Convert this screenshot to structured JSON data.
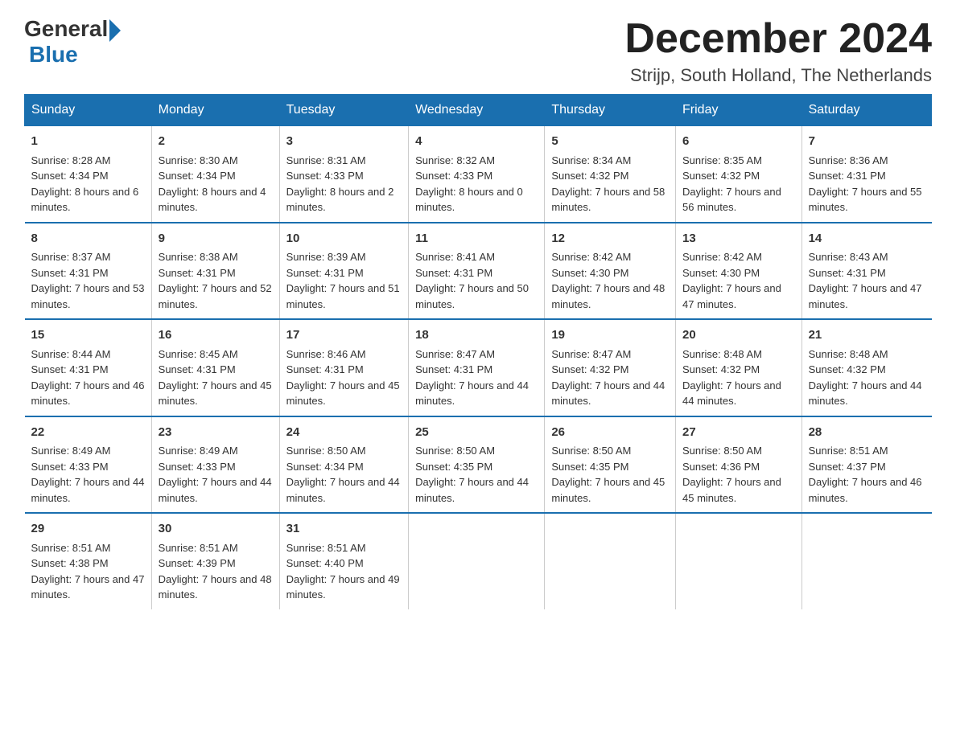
{
  "logo": {
    "general": "General",
    "blue": "Blue",
    "arrow": "▶"
  },
  "header": {
    "month_year": "December 2024",
    "location": "Strijp, South Holland, The Netherlands"
  },
  "days_of_week": [
    "Sunday",
    "Monday",
    "Tuesday",
    "Wednesday",
    "Thursday",
    "Friday",
    "Saturday"
  ],
  "weeks": [
    [
      {
        "day": "1",
        "sunrise": "8:28 AM",
        "sunset": "4:34 PM",
        "daylight": "8 hours and 6 minutes."
      },
      {
        "day": "2",
        "sunrise": "8:30 AM",
        "sunset": "4:34 PM",
        "daylight": "8 hours and 4 minutes."
      },
      {
        "day": "3",
        "sunrise": "8:31 AM",
        "sunset": "4:33 PM",
        "daylight": "8 hours and 2 minutes."
      },
      {
        "day": "4",
        "sunrise": "8:32 AM",
        "sunset": "4:33 PM",
        "daylight": "8 hours and 0 minutes."
      },
      {
        "day": "5",
        "sunrise": "8:34 AM",
        "sunset": "4:32 PM",
        "daylight": "7 hours and 58 minutes."
      },
      {
        "day": "6",
        "sunrise": "8:35 AM",
        "sunset": "4:32 PM",
        "daylight": "7 hours and 56 minutes."
      },
      {
        "day": "7",
        "sunrise": "8:36 AM",
        "sunset": "4:31 PM",
        "daylight": "7 hours and 55 minutes."
      }
    ],
    [
      {
        "day": "8",
        "sunrise": "8:37 AM",
        "sunset": "4:31 PM",
        "daylight": "7 hours and 53 minutes."
      },
      {
        "day": "9",
        "sunrise": "8:38 AM",
        "sunset": "4:31 PM",
        "daylight": "7 hours and 52 minutes."
      },
      {
        "day": "10",
        "sunrise": "8:39 AM",
        "sunset": "4:31 PM",
        "daylight": "7 hours and 51 minutes."
      },
      {
        "day": "11",
        "sunrise": "8:41 AM",
        "sunset": "4:31 PM",
        "daylight": "7 hours and 50 minutes."
      },
      {
        "day": "12",
        "sunrise": "8:42 AM",
        "sunset": "4:30 PM",
        "daylight": "7 hours and 48 minutes."
      },
      {
        "day": "13",
        "sunrise": "8:42 AM",
        "sunset": "4:30 PM",
        "daylight": "7 hours and 47 minutes."
      },
      {
        "day": "14",
        "sunrise": "8:43 AM",
        "sunset": "4:31 PM",
        "daylight": "7 hours and 47 minutes."
      }
    ],
    [
      {
        "day": "15",
        "sunrise": "8:44 AM",
        "sunset": "4:31 PM",
        "daylight": "7 hours and 46 minutes."
      },
      {
        "day": "16",
        "sunrise": "8:45 AM",
        "sunset": "4:31 PM",
        "daylight": "7 hours and 45 minutes."
      },
      {
        "day": "17",
        "sunrise": "8:46 AM",
        "sunset": "4:31 PM",
        "daylight": "7 hours and 45 minutes."
      },
      {
        "day": "18",
        "sunrise": "8:47 AM",
        "sunset": "4:31 PM",
        "daylight": "7 hours and 44 minutes."
      },
      {
        "day": "19",
        "sunrise": "8:47 AM",
        "sunset": "4:32 PM",
        "daylight": "7 hours and 44 minutes."
      },
      {
        "day": "20",
        "sunrise": "8:48 AM",
        "sunset": "4:32 PM",
        "daylight": "7 hours and 44 minutes."
      },
      {
        "day": "21",
        "sunrise": "8:48 AM",
        "sunset": "4:32 PM",
        "daylight": "7 hours and 44 minutes."
      }
    ],
    [
      {
        "day": "22",
        "sunrise": "8:49 AM",
        "sunset": "4:33 PM",
        "daylight": "7 hours and 44 minutes."
      },
      {
        "day": "23",
        "sunrise": "8:49 AM",
        "sunset": "4:33 PM",
        "daylight": "7 hours and 44 minutes."
      },
      {
        "day": "24",
        "sunrise": "8:50 AM",
        "sunset": "4:34 PM",
        "daylight": "7 hours and 44 minutes."
      },
      {
        "day": "25",
        "sunrise": "8:50 AM",
        "sunset": "4:35 PM",
        "daylight": "7 hours and 44 minutes."
      },
      {
        "day": "26",
        "sunrise": "8:50 AM",
        "sunset": "4:35 PM",
        "daylight": "7 hours and 45 minutes."
      },
      {
        "day": "27",
        "sunrise": "8:50 AM",
        "sunset": "4:36 PM",
        "daylight": "7 hours and 45 minutes."
      },
      {
        "day": "28",
        "sunrise": "8:51 AM",
        "sunset": "4:37 PM",
        "daylight": "7 hours and 46 minutes."
      }
    ],
    [
      {
        "day": "29",
        "sunrise": "8:51 AM",
        "sunset": "4:38 PM",
        "daylight": "7 hours and 47 minutes."
      },
      {
        "day": "30",
        "sunrise": "8:51 AM",
        "sunset": "4:39 PM",
        "daylight": "7 hours and 48 minutes."
      },
      {
        "day": "31",
        "sunrise": "8:51 AM",
        "sunset": "4:40 PM",
        "daylight": "7 hours and 49 minutes."
      },
      null,
      null,
      null,
      null
    ]
  ],
  "labels": {
    "sunrise": "Sunrise:",
    "sunset": "Sunset:",
    "daylight": "Daylight:"
  }
}
